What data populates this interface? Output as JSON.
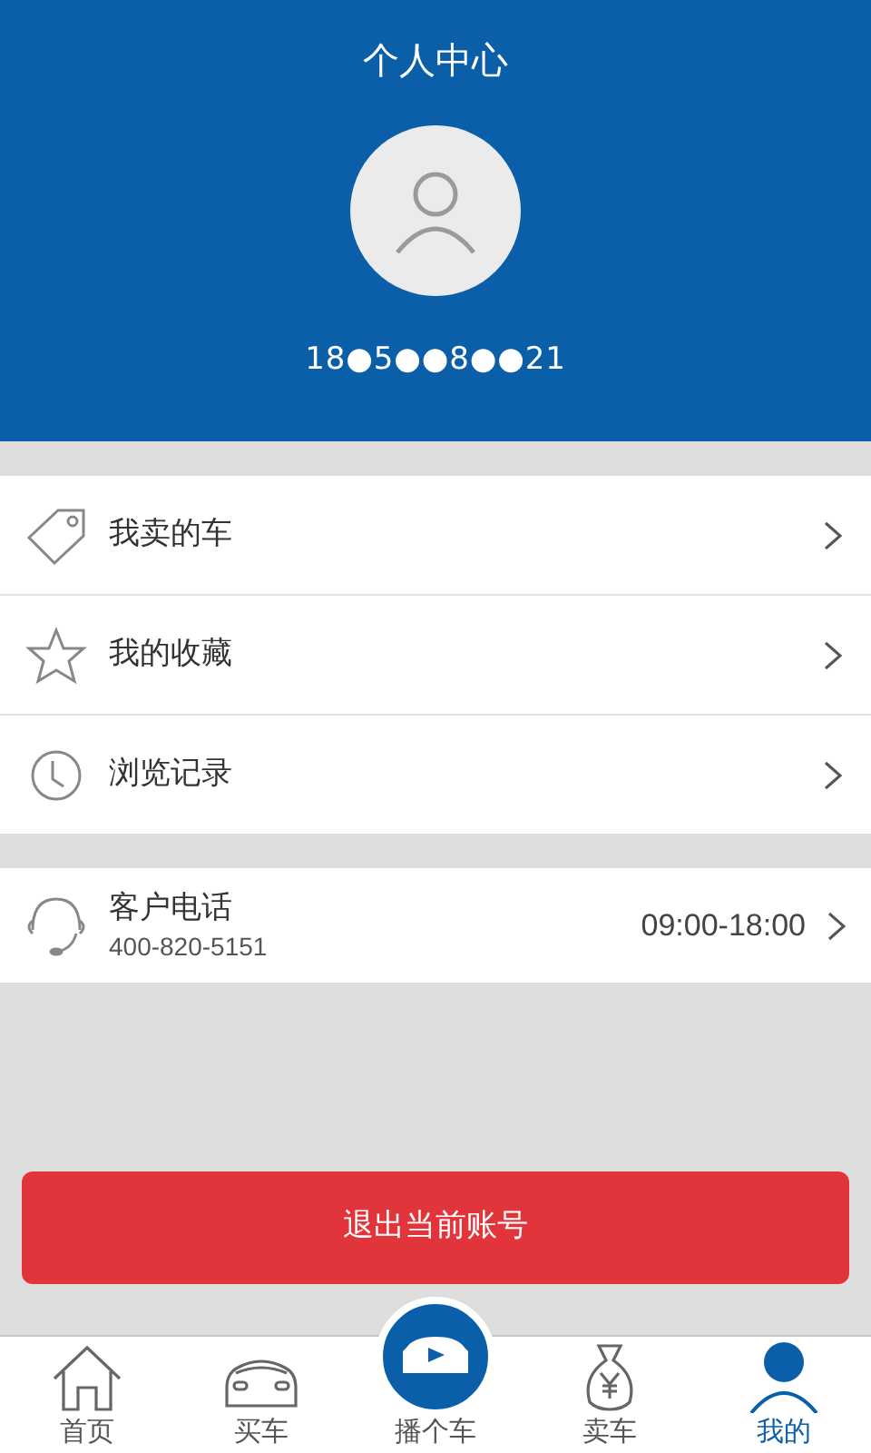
{
  "header": {
    "title": "个人中心",
    "phone": "18●5●●8●●21"
  },
  "menu": [
    {
      "kind": "tag",
      "label": "我卖的车"
    },
    {
      "kind": "star",
      "label": "我的收藏"
    },
    {
      "kind": "clock",
      "label": "浏览记录"
    }
  ],
  "service": {
    "title": "客户电话",
    "number": "400-820-5151",
    "hours": "09:00-18:00"
  },
  "logout_button": "退出当前账号",
  "tabs": [
    {
      "kind": "home",
      "label": "首页",
      "selected": false
    },
    {
      "kind": "car",
      "label": "买车",
      "selected": false
    },
    {
      "kind": "play",
      "label": "播个车",
      "selected": false
    },
    {
      "kind": "money",
      "label": "卖车",
      "selected": false
    },
    {
      "kind": "user",
      "label": "我的",
      "selected": true
    }
  ]
}
